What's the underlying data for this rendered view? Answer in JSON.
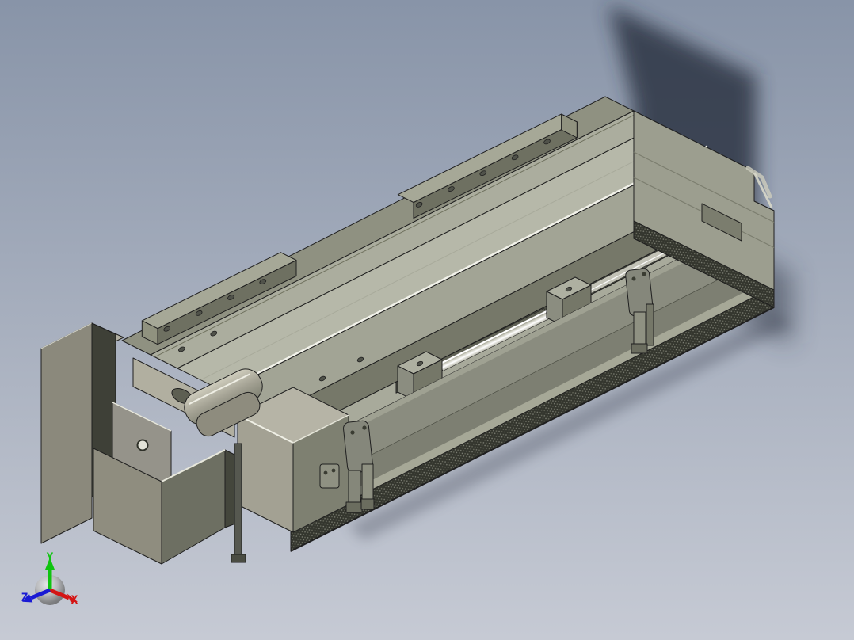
{
  "scene": {
    "type": "cad-3d-model-preview",
    "background": {
      "top": "#8894a8",
      "bottom": "#c6cad4"
    }
  },
  "axis_triad": {
    "labels": {
      "x": "X",
      "y": "Y",
      "z": "Z"
    },
    "colors": {
      "x": "#d41414",
      "y": "#0fc40f",
      "z": "#1a1ad4",
      "ball": "#9a9a9a"
    }
  },
  "model": {
    "name": "linear-motion-stage",
    "parts": [
      {
        "id": "base-extrusion"
      },
      {
        "id": "slide-table"
      },
      {
        "id": "ball-screw"
      },
      {
        "id": "screw-clamp-blocks"
      },
      {
        "id": "back-mount-rails"
      },
      {
        "id": "stepper-motor"
      },
      {
        "id": "motor-mount-bracket"
      },
      {
        "id": "end-bearing-block"
      },
      {
        "id": "limit-sensor-brackets"
      },
      {
        "id": "end-cap"
      }
    ],
    "palette": {
      "outline": "#1f1f1f",
      "back_strip": "#8f9181",
      "top_strip": "#abad9e",
      "table_top": "#b6b8a9",
      "front_strip": "#a2a495",
      "step_face": "#767869",
      "shelf": "#a8aa9b",
      "slot": "#4e5045",
      "front_face": "#8a8c7f",
      "front_light": "#9fa192",
      "front_mid": "#7d7f72",
      "rail_band": "#a6a897",
      "knurl": "#34362e",
      "end_face": "#9c9e8f",
      "rail_top": "#a6a897",
      "rail_front": "#6e7061",
      "motor_light": "#8f8d7f",
      "motor_dark": "#6d6f62",
      "plate": "#8b897c",
      "highlight": "#f2f2ea",
      "shadow": "#2c3340",
      "hole": "#50524a"
    }
  }
}
